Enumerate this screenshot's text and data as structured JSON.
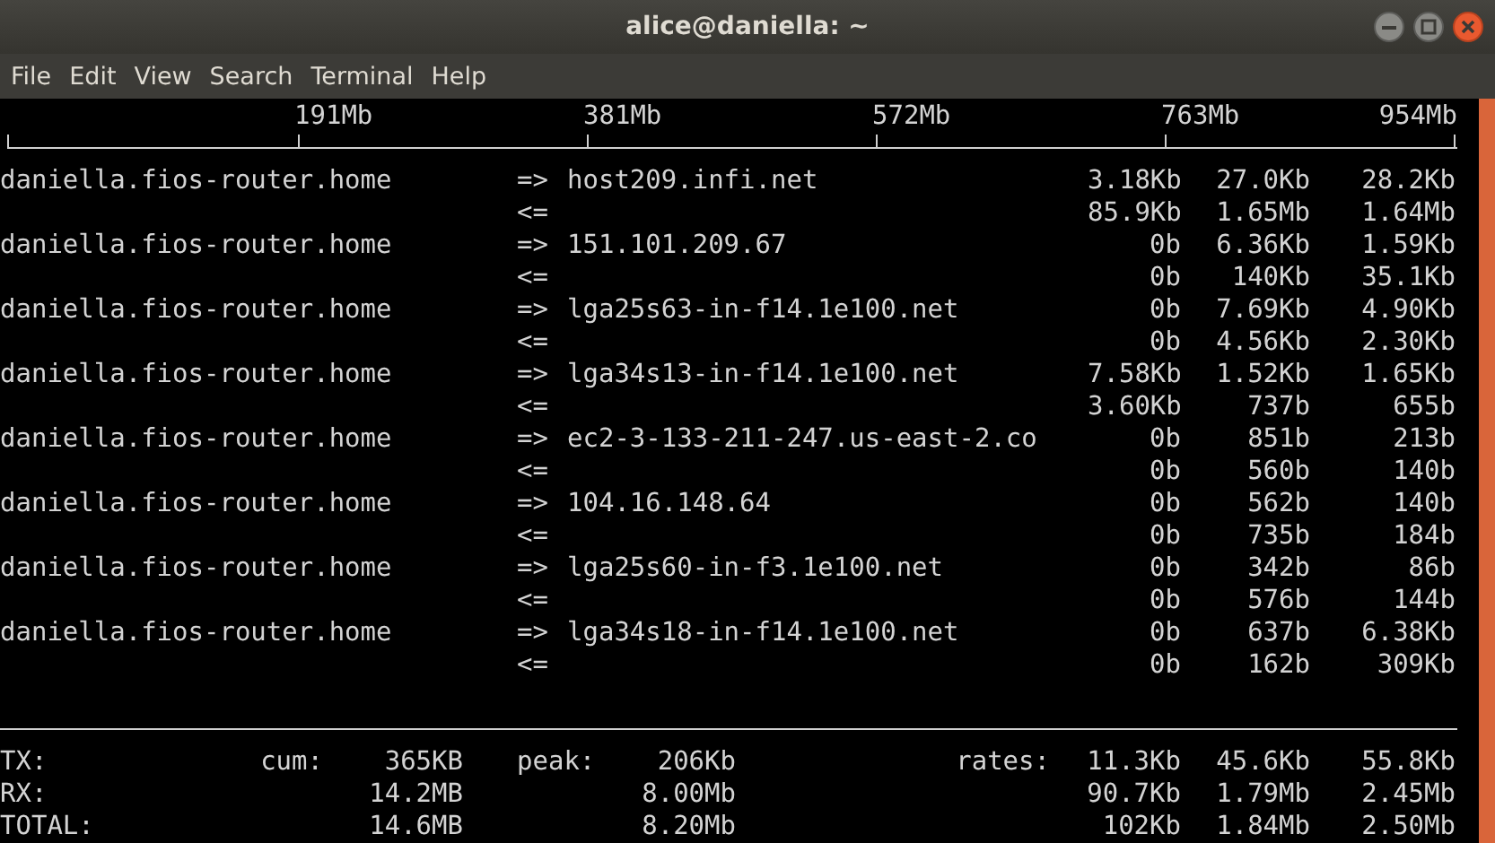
{
  "window": {
    "title": "alice@daniella: ~"
  },
  "menu": [
    "File",
    "Edit",
    "View",
    "Search",
    "Terminal",
    "Help"
  ],
  "scale": [
    "191Mb",
    "381Mb",
    "572Mb",
    "763Mb",
    "954Mb"
  ],
  "connections": [
    {
      "local": "daniella.fios-router.home",
      "sent": {
        "direction": "=>",
        "remote": "host209.infi.net",
        "rates": [
          "3.18Kb",
          "27.0Kb",
          "28.2Kb"
        ]
      },
      "received": {
        "direction": "<=",
        "rates": [
          "85.9Kb",
          "1.65Mb",
          "1.64Mb"
        ]
      }
    },
    {
      "local": "daniella.fios-router.home",
      "sent": {
        "direction": "=>",
        "remote": "151.101.209.67",
        "rates": [
          "0b",
          "6.36Kb",
          "1.59Kb"
        ]
      },
      "received": {
        "direction": "<=",
        "rates": [
          "0b",
          "140Kb",
          "35.1Kb"
        ]
      }
    },
    {
      "local": "daniella.fios-router.home",
      "sent": {
        "direction": "=>",
        "remote": "lga25s63-in-f14.1e100.net",
        "rates": [
          "0b",
          "7.69Kb",
          "4.90Kb"
        ]
      },
      "received": {
        "direction": "<=",
        "rates": [
          "0b",
          "4.56Kb",
          "2.30Kb"
        ]
      }
    },
    {
      "local": "daniella.fios-router.home",
      "sent": {
        "direction": "=>",
        "remote": "lga34s13-in-f14.1e100.net",
        "rates": [
          "7.58Kb",
          "1.52Kb",
          "1.65Kb"
        ]
      },
      "received": {
        "direction": "<=",
        "rates": [
          "3.60Kb",
          "737b",
          "655b"
        ]
      }
    },
    {
      "local": "daniella.fios-router.home",
      "sent": {
        "direction": "=>",
        "remote": "ec2-3-133-211-247.us-east-2.co",
        "rates": [
          "0b",
          "851b",
          "213b"
        ]
      },
      "received": {
        "direction": "<=",
        "rates": [
          "0b",
          "560b",
          "140b"
        ]
      }
    },
    {
      "local": "daniella.fios-router.home",
      "sent": {
        "direction": "=>",
        "remote": "104.16.148.64",
        "rates": [
          "0b",
          "562b",
          "140b"
        ]
      },
      "received": {
        "direction": "<=",
        "rates": [
          "0b",
          "735b",
          "184b"
        ]
      }
    },
    {
      "local": "daniella.fios-router.home",
      "sent": {
        "direction": "=>",
        "remote": "lga25s60-in-f3.1e100.net",
        "rates": [
          "0b",
          "342b",
          "86b"
        ]
      },
      "received": {
        "direction": "<=",
        "rates": [
          "0b",
          "576b",
          "144b"
        ]
      }
    },
    {
      "local": "daniella.fios-router.home",
      "sent": {
        "direction": "=>",
        "remote": "lga34s18-in-f14.1e100.net",
        "rates": [
          "0b",
          "637b",
          "6.38Kb"
        ]
      },
      "received": {
        "direction": "<=",
        "rates": [
          "0b",
          "162b",
          "309Kb"
        ]
      }
    }
  ],
  "totals": [
    {
      "label": "TX:",
      "cum_label": "cum:",
      "cum": "365KB",
      "peak_label": "peak:",
      "peak": "206Kb",
      "rates_label": "rates:",
      "rates": [
        "11.3Kb",
        "45.6Kb",
        "55.8Kb"
      ]
    },
    {
      "label": "RX:",
      "cum": "14.2MB",
      "peak": "8.00Mb",
      "rates": [
        "90.7Kb",
        "1.79Mb",
        "2.45Mb"
      ]
    },
    {
      "label": "TOTAL:",
      "cum": "14.6MB",
      "peak": "8.20Mb",
      "rates": [
        "102Kb",
        "1.84Mb",
        "2.50Mb"
      ]
    }
  ]
}
